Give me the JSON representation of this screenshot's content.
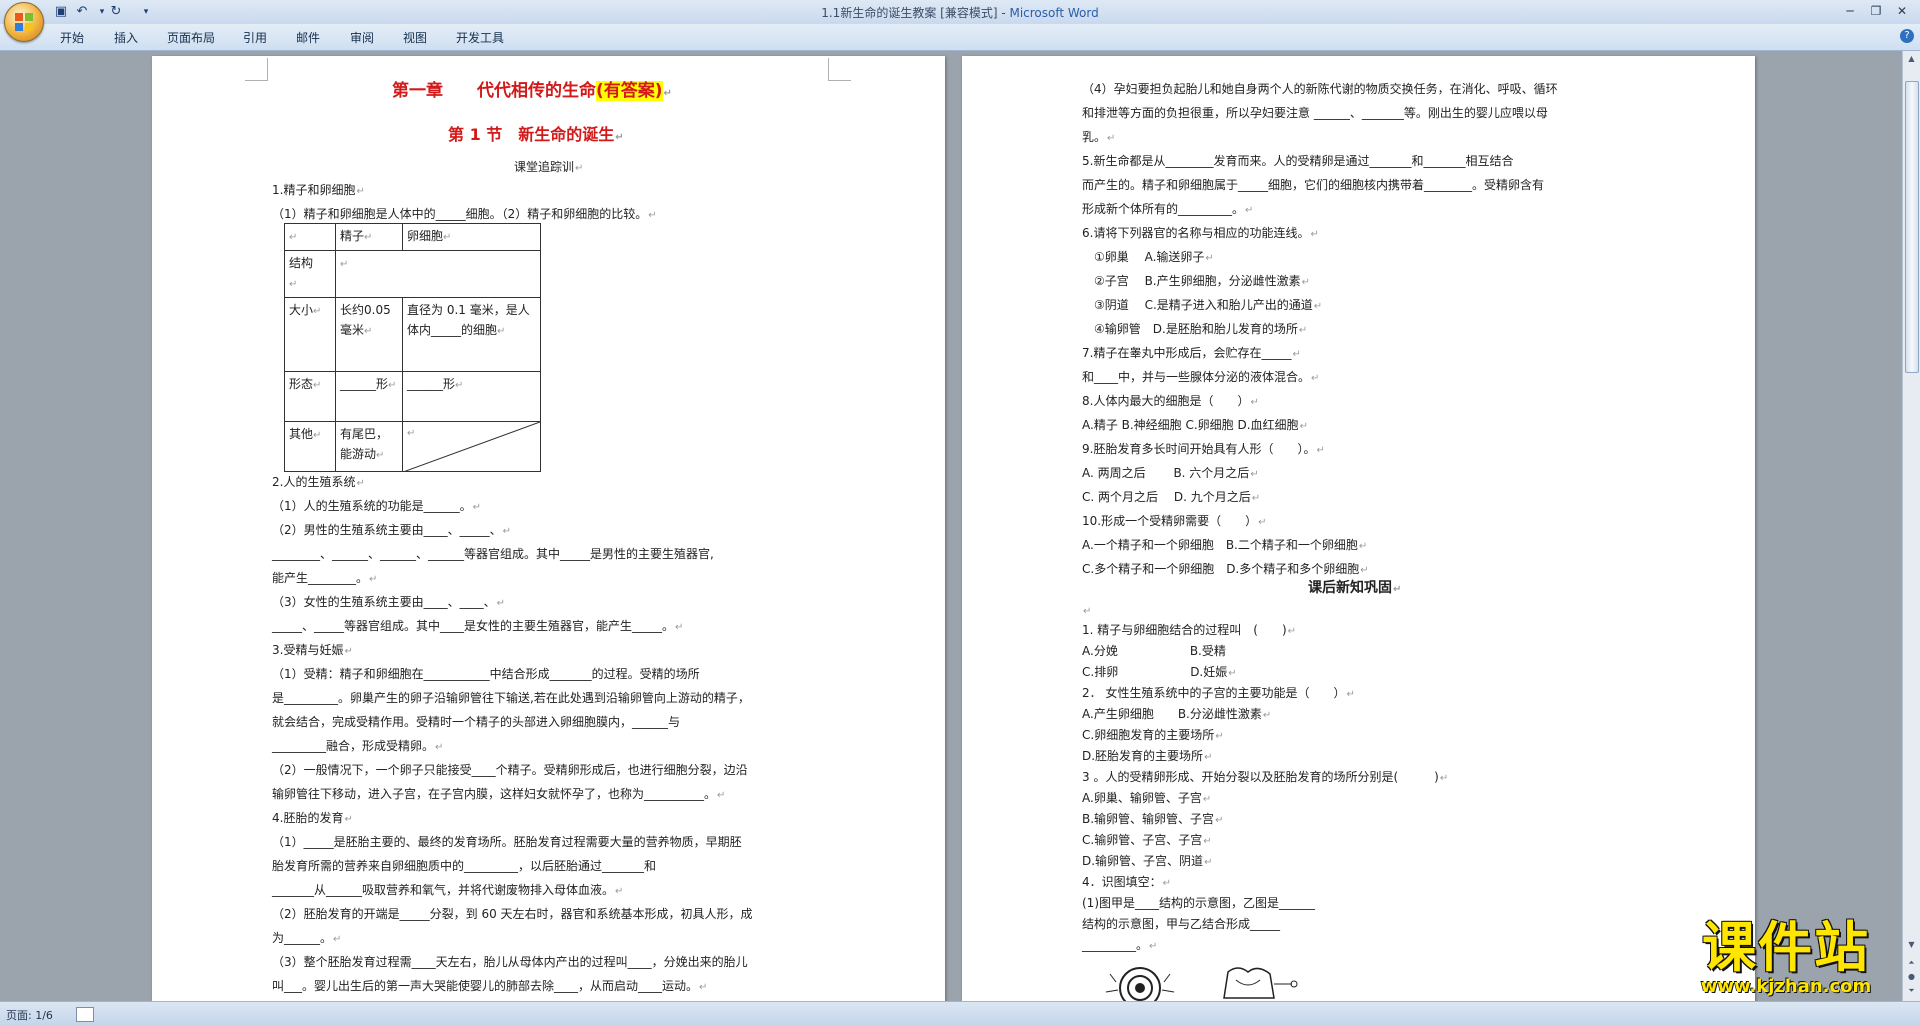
{
  "window": {
    "title": "1.1新生命的诞生教案 [兼容模式]",
    "separator": " - ",
    "app_name": "Microsoft Word"
  },
  "ribbon": {
    "tabs": [
      "开始",
      "插入",
      "页面布局",
      "引用",
      "邮件",
      "审阅",
      "视图",
      "开发工具"
    ]
  },
  "page_left": {
    "title": "第一章　　代代相传的生命",
    "title_highlight": "(有答案)",
    "section_title": "第 1 节　新生命的诞生",
    "subtitle": "课堂追踪训",
    "lines": [
      "1.精子和卵细胞",
      "（1）精子和卵细胞是人体中的_____细胞。（2）精子和卵细胞的比较。",
      "2.人的生殖系统",
      "（1）人的生殖系统的功能是______。",
      "（2）男性的生殖系统主要由____、_____、",
      "________、______、______、______等器官组成。其中_____是男性的主要生殖器官,",
      "能产生________。",
      "（3）女性的生殖系统主要由____、____、",
      "_____、_____等器官组成。其中____是女性的主要生殖器官，能产生_____。",
      "3.受精与妊娠",
      "（1）受精：精子和卵细胞在___________中结合形成_______的过程。受精的场所",
      "是_________。卵巢产生的卵子沿输卵管往下输送,若在此处遇到沿输卵管向上游动的精子，",
      "就会结合，完成受精作用。受精时一个精子的头部进入卵细胞膜内，______与",
      "_________融合，形成受精卵。",
      "（2）一般情况下，一个卵子只能接受____个精子。受精卵形成后，也进行细胞分裂，边沿",
      "输卵管往下移动，进入子宫，在子宫内膜，这样妇女就怀孕了，也称为__________。",
      "4.胚胎的发育",
      "（1）_____是胚胎主要的、最终的发育场所。胚胎发育过程需要大量的营养物质，早期胚",
      "胎发育所需的营养来自卵细胞质中的_________，以后胚胎通过_______和",
      "_______从______吸取营养和氧气，并将代谢废物排入母体血液。",
      "（2）胚胎发育的开端是_____分裂，到 60 天左右时，器官和系统基本形成，初具人形，成",
      "为______。",
      "（3）整个胚胎发育过程需____天左右，胎儿从母体内产出的过程叫____，分娩出来的胎儿",
      "叫___。婴儿出生后的第一声大哭能使婴儿的肺部去除____，从而启动____运动。"
    ],
    "table": {
      "headers": [
        "",
        "精子",
        "卵细胞"
      ],
      "rows": [
        [
          "结构",
          "",
          ""
        ],
        [
          "大小",
          "长约0.05毫米",
          "直径为 0.1 毫米，是人体内_____的细胞"
        ],
        [
          "形态",
          "______形",
          "______形"
        ],
        [
          "其他",
          "有尾巴，能游动",
          ""
        ]
      ]
    }
  },
  "page_right": {
    "lines": [
      "（4）孕妇要担负起胎儿和她自身两个人的新陈代谢的物质交换任务，在消化、呼吸、循环",
      "和排泄等方面的负担很重，所以孕妇要注意 ______、_______等。刚出生的婴儿应喂以母",
      "乳。",
      "5.新生命都是从________发育而来。人的受精卵是通过_______和_______相互结合",
      "而产生的。精子和卵细胞属于_____细胞，它们的细胞核内携带着________。受精卵含有",
      "形成新个体所有的_________。",
      "6.请将下列器官的名称与相应的功能连线。",
      "　①卵巢　 A.输送卵子",
      "　②子宫　 B.产生卵细胞，分泌雌性激素",
      "　③阴道　 C.是精子进入和胎儿产出的通道",
      "　④输卵管　D.是胚胎和胎儿发育的场所",
      "7.精子在睾丸中形成后，会贮存在_____",
      "和____中，并与一些腺体分泌的液体混合。",
      "8.人体内最大的细胞是（　　）",
      " A.精子 B.神经细胞 C.卵细胞 D.血红细胞",
      "9.胚胎发育多长时间开始具有人形（　　）。",
      " A. 两周之后　　 B. 六个月之后",
      " C. 两个月之后　 D. 九个月之后",
      "10.形成一个受精卵需要（　　）",
      "A.一个精子和一个卵细胞　B.二个精子和一个卵细胞",
      "C.多个精子和一个卵细胞　D.多个精子和多个卵细胞"
    ],
    "section_title": "课后新知巩固",
    "lines2": [
      "1. 精子与卵细胞结合的过程叫　(　　)",
      "A.分娩　　　　　　B.受精",
      "C.排卵　　　　　　D.妊娠",
      "2． 女性生殖系统中的子宫的主要功能是（　　）",
      "A.产生卵细胞　　B.分泌雌性激素",
      "C.卵细胞发育的主要场所",
      "D.胚胎发育的主要场所",
      "3 。人的受精卵形成、开始分裂以及胚胎发育的场所分别是(　　　)",
      "A.卵巢、输卵管、子宫",
      "B.输卵管、输卵管、子宫",
      "C.输卵管、子宫、子宫",
      "D.输卵管、子宫、阴道",
      "4．识图填空：",
      "(1)图甲是____结构的示意图，乙图是______",
      "结构的示意图，甲与乙结合形成_____",
      "_________。"
    ]
  },
  "status": {
    "page_label": "页面: 1/6"
  },
  "watermark": {
    "text": "课件站",
    "url": "www.kjzhan.com"
  }
}
